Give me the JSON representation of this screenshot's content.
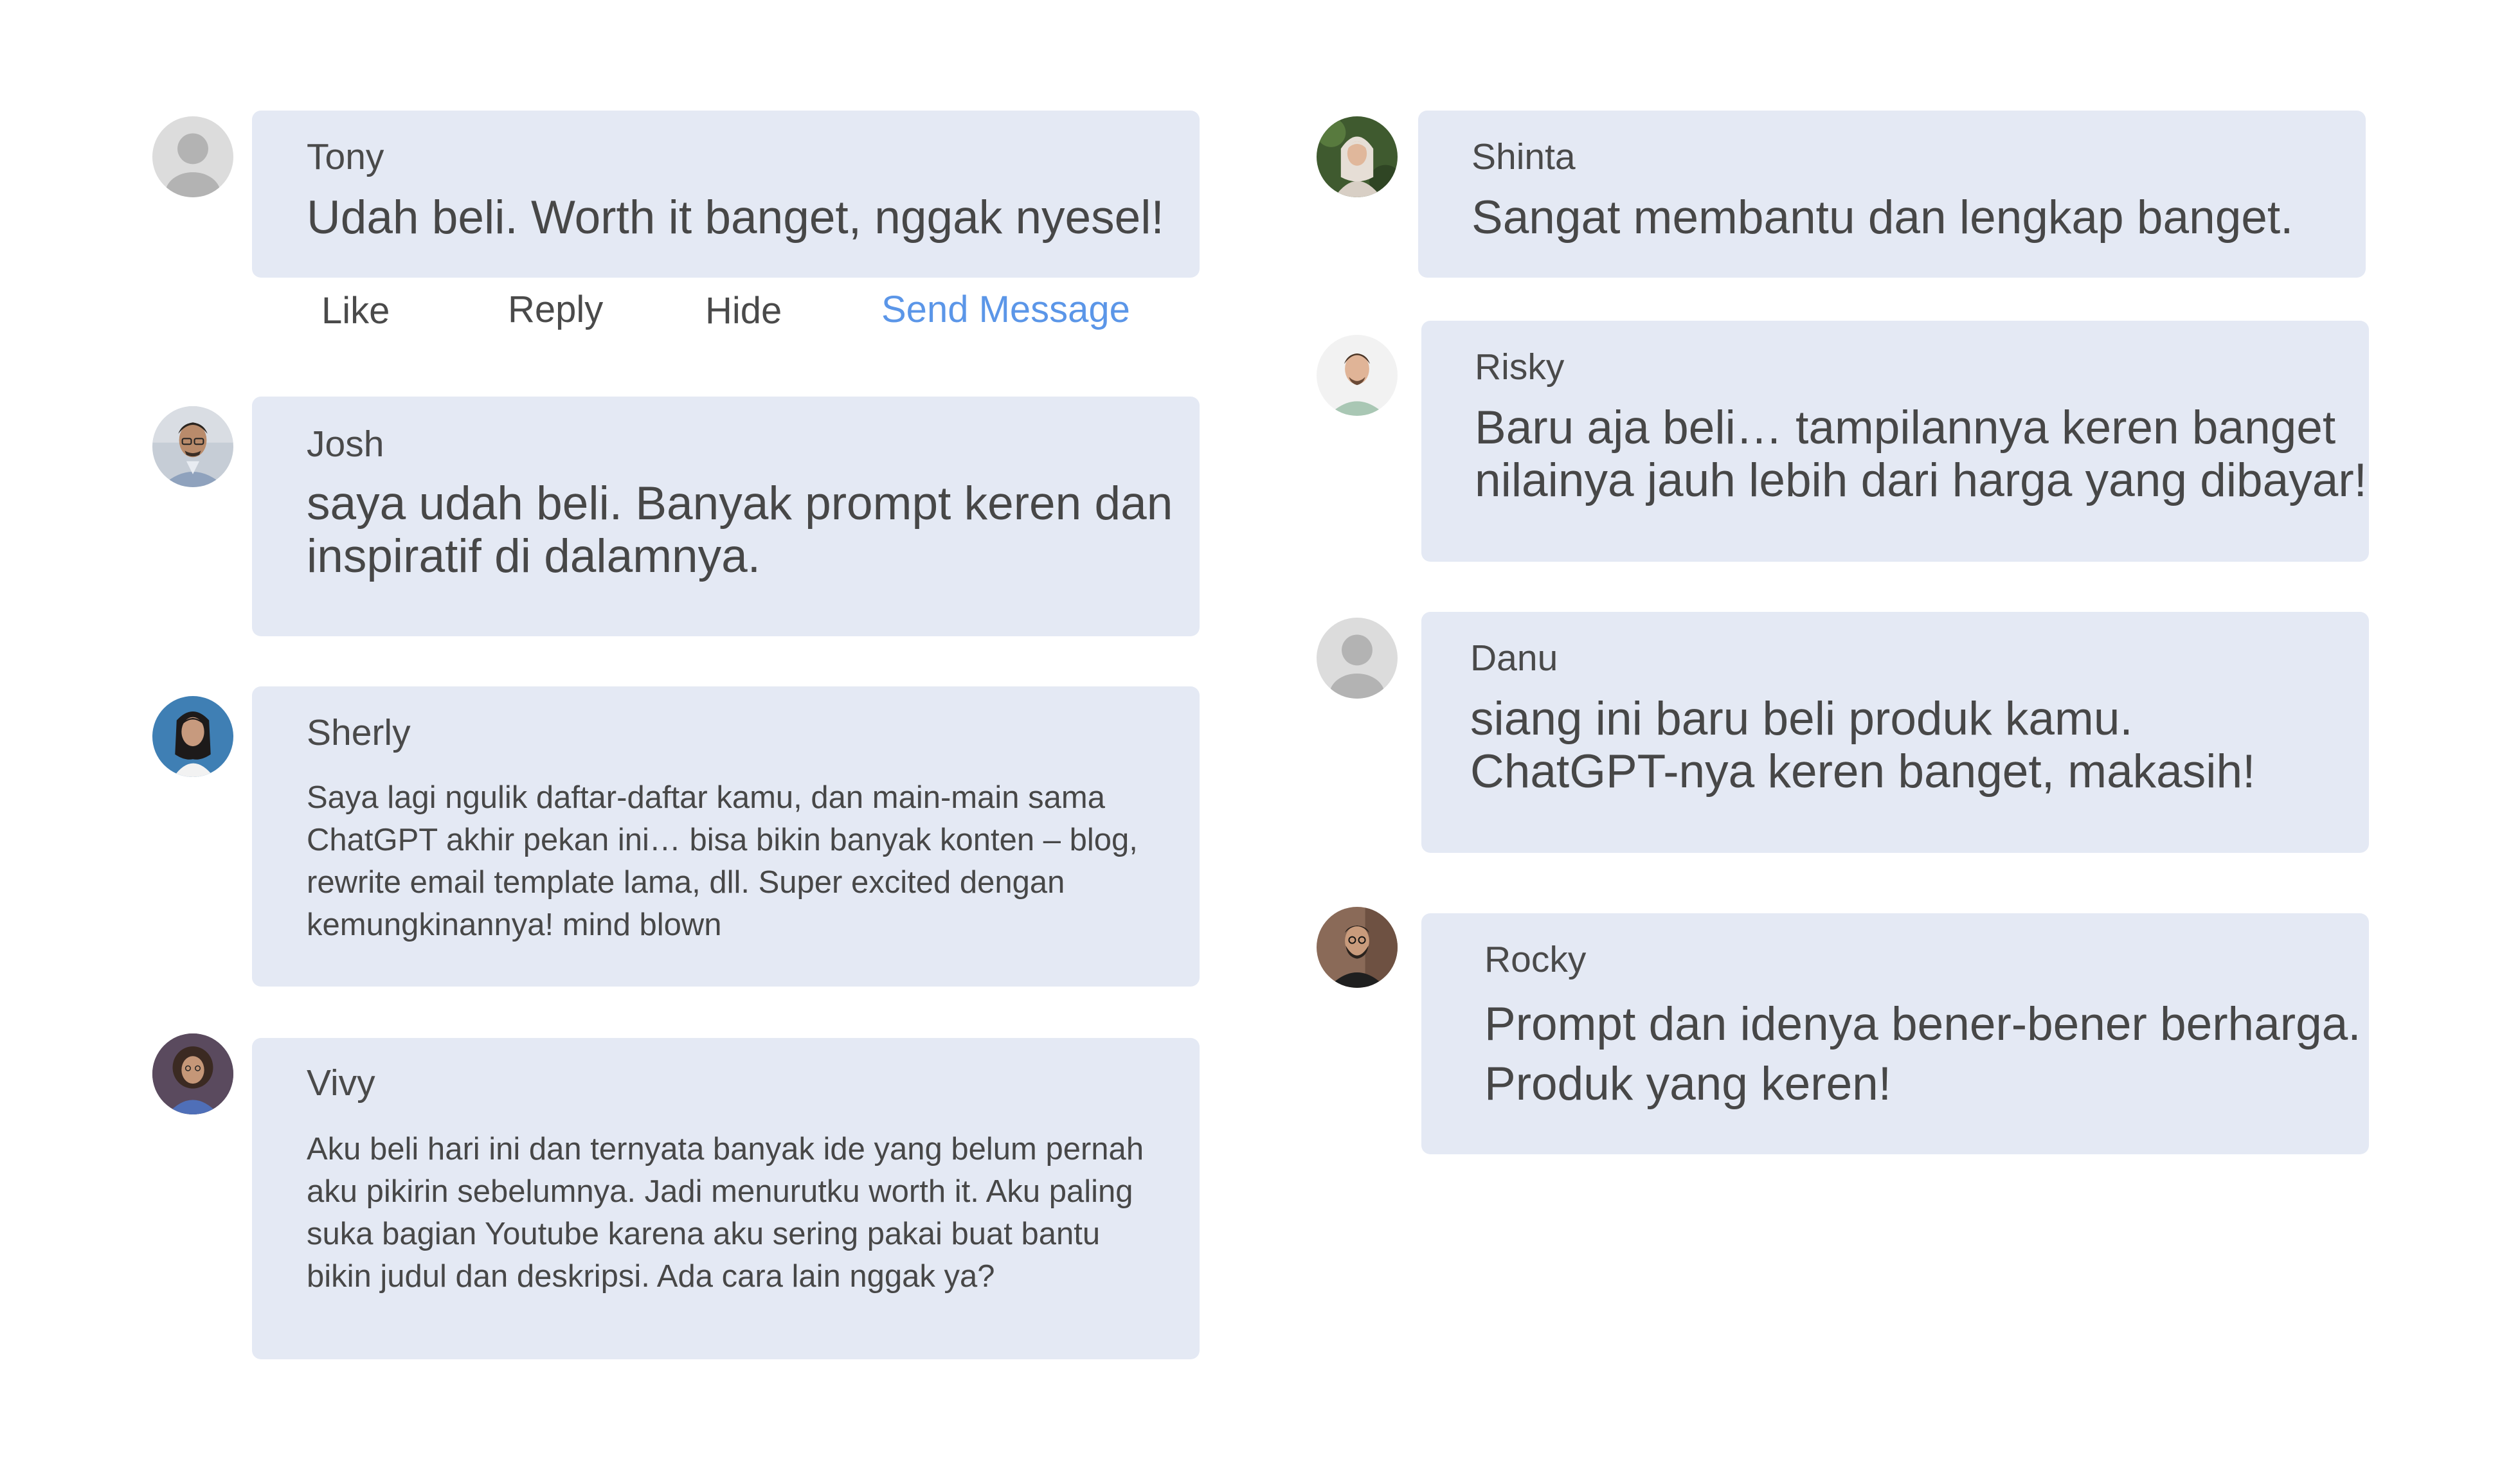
{
  "colors": {
    "bubble": "#e4e9f4",
    "text": "#474747",
    "link": "#5b96e8",
    "placeholder_avatar": "#d8d8d8"
  },
  "comments": [
    {
      "name": "Tony",
      "message": "Udah beli. Worth it banget, nggak nyesel!",
      "avatar": "placeholder-avatar-icon",
      "actions": [
        "Like",
        "Reply",
        "Hide",
        "Send Message"
      ]
    },
    {
      "name": "Josh",
      "message": "saya udah beli. Banyak prompt keren dan\ninspiratif di dalamnya.",
      "avatar": "man-glasses-photo"
    },
    {
      "name": "Sherly",
      "message": "Saya lagi ngulik daftar-daftar kamu, dan main-main sama\nChatGPT akhir pekan ini… bisa bikin banyak konten – blog,\nrewrite email template lama, dll. Super excited dengan\nkemungkinannya! mind blown",
      "avatar": "woman-blue-background-photo"
    },
    {
      "name": "Vivy",
      "message": "Aku beli hari ini dan ternyata banyak ide yang belum pernah\naku pikirin sebelumnya. Jadi menurutku worth it. Aku paling\nsuka bagian Youtube karena aku sering pakai buat bantu\nbikin judul dan deskripsi. Ada cara lain nggak ya?",
      "avatar": "woman-curly-hair-photo"
    },
    {
      "name": "Shinta",
      "message": "Sangat membantu dan lengkap banget.",
      "avatar": "woman-hijab-photo"
    },
    {
      "name": "Risky",
      "message": "Baru aja beli… tampilannya keren banget\nnilainya jauh lebih dari harga yang dibayar!",
      "avatar": "man-green-shirt-photo"
    },
    {
      "name": "Danu",
      "message": "siang ini baru beli produk kamu.\nChatGPT-nya keren banget, makasih!",
      "avatar": "placeholder-avatar-icon"
    },
    {
      "name": "Rocky",
      "message": "Prompt dan idenya bener-bener berharga.\nProduk yang keren!",
      "avatar": "man-beard-glasses-photo"
    }
  ]
}
